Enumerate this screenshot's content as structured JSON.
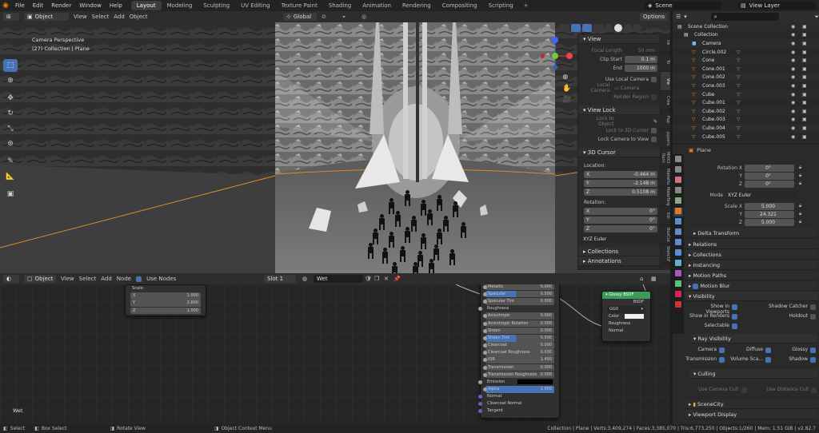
{
  "topbar": {
    "menus": [
      "File",
      "Edit",
      "Render",
      "Window",
      "Help"
    ],
    "workspaces": [
      "Layout",
      "Modeling",
      "Sculpting",
      "UV Editing",
      "Texture Paint",
      "Shading",
      "Animation",
      "Rendering",
      "Compositing",
      "Scripting"
    ],
    "active_workspace": "Layout",
    "scene": "Scene",
    "view_layer": "View Layer"
  },
  "viewport_header": {
    "mode": "Object Mode",
    "menus": [
      "View",
      "Select",
      "Add",
      "Object"
    ],
    "transform": "Global",
    "options": "Options"
  },
  "viewport": {
    "overlay_title": "Camera Perspective",
    "overlay_sub": "(27) Collection | Plane"
  },
  "npanel": {
    "tabs": [
      "Ite",
      "To",
      "Vie",
      "Crea",
      "Pap",
      "pypers",
      "MHX2 Runt",
      "MakeHu",
      "MakeTarg",
      "Edi",
      "BoxCut",
      "SketchF"
    ],
    "view": {
      "title": "View",
      "focal_length_label": "Focal Length",
      "focal_length": "50 mm",
      "clip_start_label": "Clip Start",
      "clip_start": "0.1 m",
      "end_label": "End",
      "end": "1000 m",
      "local_camera_toggle": "Use Local Camera",
      "local_camera_label": "Local Camera",
      "local_camera_value": "Camera",
      "render_region": "Render Region"
    },
    "view_lock": {
      "title": "View Lock",
      "lock_to_object": "Lock to Object",
      "lock_to_cursor": "Lock to 3D Cursor",
      "lock_camera": "Lock Camera to View"
    },
    "cursor": {
      "title": "3D Cursor",
      "location_label": "Location:",
      "x": "-0.464 m",
      "y": "-2.148 m",
      "z": "0.5108 m",
      "rotation_label": "Rotation:",
      "rx": "0°",
      "ry": "0°",
      "rz": "0°",
      "mode": "XYZ Euler"
    },
    "collections": "Collections",
    "annotations": "Annotations"
  },
  "node_header": {
    "editor": "Object",
    "menus": [
      "View",
      "Select",
      "Add",
      "Node"
    ],
    "use_nodes": "Use Nodes",
    "slot": "Slot 1",
    "material": "Wet"
  },
  "nodes": {
    "scale_node": {
      "title": "Scale:",
      "x": "1.000",
      "y": "2.800",
      "z": "1.000"
    },
    "principled": {
      "rows": [
        {
          "label": "Metallic",
          "value": "0.000",
          "kind": "slider"
        },
        {
          "label": "Specular",
          "value": "0.500",
          "kind": "blue"
        },
        {
          "label": "Specular Tint",
          "value": "0.000",
          "kind": "slider"
        },
        {
          "label": "Roughness",
          "value": "",
          "kind": "socket"
        },
        {
          "label": "Anisotropic",
          "value": "0.000",
          "kind": "slider"
        },
        {
          "label": "Anisotropic Rotation",
          "value": "0.000",
          "kind": "slider"
        },
        {
          "label": "Sheen",
          "value": "0.000",
          "kind": "slider"
        },
        {
          "label": "Sheen Tint",
          "value": "0.500",
          "kind": "blue"
        },
        {
          "label": "Clearcoat",
          "value": "0.000",
          "kind": "slider"
        },
        {
          "label": "Clearcoat Roughness",
          "value": "0.030",
          "kind": "slider"
        },
        {
          "label": "IOR",
          "value": "1.450",
          "kind": "slider"
        },
        {
          "label": "Transmission",
          "value": "0.000",
          "kind": "slider"
        },
        {
          "label": "Transmission Roughness",
          "value": "0.000",
          "kind": "slider"
        },
        {
          "label": "Emission",
          "value": "",
          "kind": "color"
        },
        {
          "label": "Alpha",
          "value": "1.000",
          "kind": "full"
        },
        {
          "label": "Normal",
          "value": "",
          "kind": "socket"
        },
        {
          "label": "Clearcoat Normal",
          "value": "",
          "kind": "socket"
        },
        {
          "label": "Tangent",
          "value": "",
          "kind": "socket"
        }
      ]
    },
    "glossy": {
      "title": "Glossy BSDF",
      "output": "BSDF",
      "distribution": "GGX",
      "color": "Color",
      "roughness": "Roughness",
      "normal": "Normal"
    },
    "corner_label": "Wet"
  },
  "statusbar": {
    "select": "Select",
    "box_select": "Box Select",
    "rotate_view": "Rotate View",
    "context_menu": "Object Context Menu",
    "stats": "Collection | Plane | Verts:3,409,274 | Faces:3,385,070 | Tris:6,773,250 | Objects:1/260 | Mem: 1.51 GiB | v2.82.7"
  },
  "outliner": {
    "root": "Scene Collection",
    "collection": "Collection",
    "items": [
      "Camera",
      "Circle.002",
      "Cone",
      "Cone.001",
      "Cone.002",
      "Cone.003",
      "Cube",
      "Cube.001",
      "Cube.002",
      "Cube.003",
      "Cube.004",
      "Cube.005"
    ]
  },
  "properties": {
    "object_name": "Plane",
    "rotation_x_label": "Rotation X",
    "rotation_y_label": "Y",
    "rotation_z_label": "Z",
    "rx": "0°",
    "ry": "0°",
    "rz": "0°",
    "mode_label": "Mode",
    "mode": "XYZ Euler",
    "scale_x_label": "Scale X",
    "scale_y_label": "Y",
    "scale_z_label": "Z",
    "sx": "5.000",
    "sy": "24.321",
    "sz": "5.000",
    "delta_transform": "Delta Transform",
    "relations": "Relations",
    "collections": "Collections",
    "instancing": "Instancing",
    "motion_paths": "Motion Paths",
    "motion_blur": "Motion Blur",
    "visibility": "Visibility",
    "show_viewports": "Show in Viewports",
    "shadow_catcher": "Shadow Catcher",
    "show_renders": "Show in Renders",
    "holdout": "Holdout",
    "selectable": "Selectable",
    "ray_visibility": "Ray Visibility",
    "camera": "Camera",
    "diffuse": "Diffuse",
    "glossy": "Glossy",
    "transmission": "Transmission",
    "volume_scatter": "Volume Sca...",
    "shadow": "Shadow",
    "culling": "Culling",
    "use_camera_cull": "Use Camera Cull",
    "use_distance_cull": "Use Distance Cull",
    "scenecity": "SceneCity",
    "viewport_display": "Viewport Display"
  },
  "colors": {
    "accent": "#4772b3",
    "object_orange": "#e0873c",
    "mesh_green": "#5fbf7f"
  }
}
